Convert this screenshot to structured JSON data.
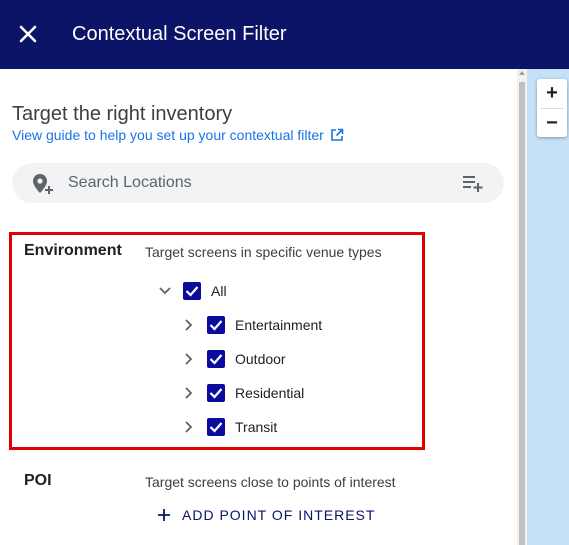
{
  "header": {
    "title": "Contextual Screen Filter"
  },
  "main": {
    "heading": "Target the right inventory",
    "guide_link": "View guide to help you set up your contextual filter",
    "search": {
      "placeholder": "Search Locations"
    },
    "environment": {
      "label": "Environment",
      "description": "Target screens in specific venue types",
      "tree": {
        "root": {
          "label": "All",
          "checked": true,
          "expanded": true
        },
        "children": [
          {
            "label": "Entertainment",
            "checked": true
          },
          {
            "label": "Outdoor",
            "checked": true
          },
          {
            "label": "Residential",
            "checked": true
          },
          {
            "label": "Transit",
            "checked": true
          }
        ]
      }
    },
    "poi": {
      "label": "POI",
      "description": "Target screens close to points of interest",
      "add_button": "ADD POINT OF INTEREST"
    }
  },
  "map": {
    "zoom_in": "+",
    "zoom_out": "−"
  },
  "colors": {
    "header_bg": "#0b1467",
    "checkbox": "#0b0b9c",
    "link": "#1a73e8",
    "highlight_border": "#e00000",
    "map_bg": "#c5e1f7"
  },
  "icons": [
    "close-icon",
    "external-link-icon",
    "location-pin-add-icon",
    "playlist-add-icon",
    "chevron-down-icon",
    "chevron-right-icon",
    "check-icon",
    "plus-icon"
  ]
}
